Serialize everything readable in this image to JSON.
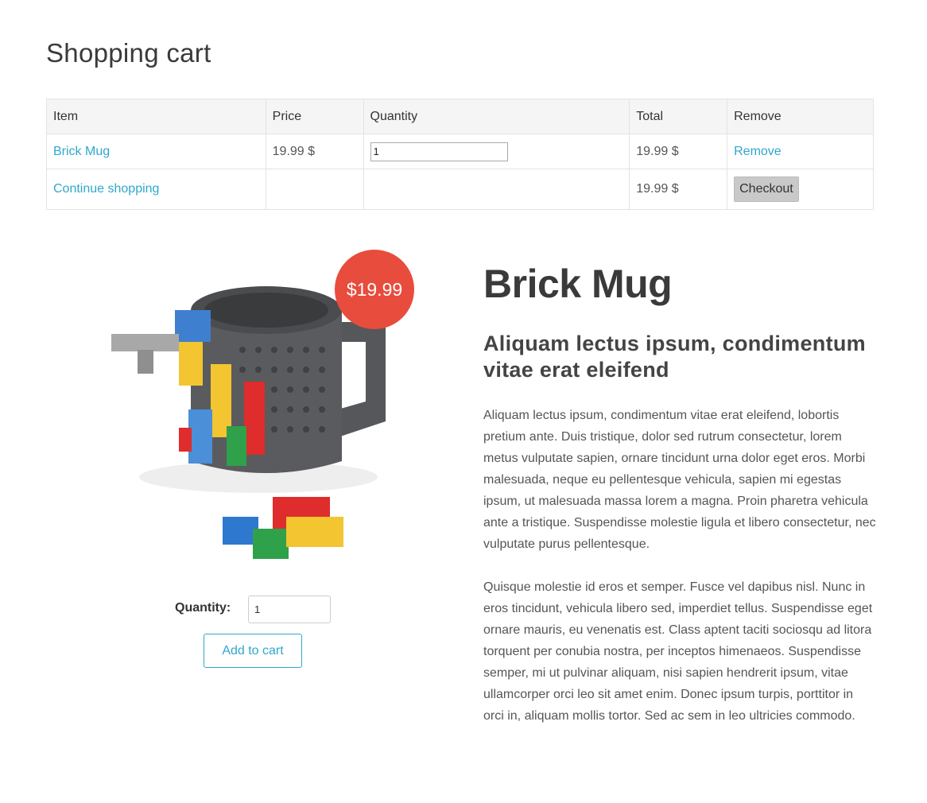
{
  "page": {
    "title": "Shopping cart"
  },
  "cart": {
    "headers": {
      "item": "Item",
      "price": "Price",
      "quantity": "Quantity",
      "total": "Total",
      "remove": "Remove"
    },
    "items": [
      {
        "name": "Brick Mug",
        "price": "19.99 $",
        "quantity": "1",
        "total": "19.99 $",
        "remove_label": "Remove"
      }
    ],
    "footer": {
      "continue_label": "Continue shopping",
      "grand_total": "19.99 $",
      "checkout_label": "Checkout"
    }
  },
  "product": {
    "price_badge": "$19.99",
    "title": "Brick Mug",
    "subtitle": "Aliquam lectus ipsum, condimentum vitae erat eleifend",
    "quantity_label": "Quantity:",
    "quantity_value": "1",
    "add_to_cart_label": "Add to cart",
    "description": [
      "Aliquam lectus ipsum, condimentum vitae erat eleifend, lobortis pretium ante. Duis tristique, dolor sed rutrum consectetur, lorem metus vulputate sapien, ornare tincidunt urna dolor eget eros. Morbi malesuada, neque eu pellentesque vehicula, sapien mi egestas ipsum, ut malesuada massa lorem a magna. Proin pharetra vehicula ante a tristique. Suspendisse molestie ligula et libero consectetur, nec vulputate purus pellentesque.",
      "Quisque molestie id eros et semper. Fusce vel dapibus nisl. Nunc in eros tincidunt, vehicula libero sed, imperdiet tellus. Suspendisse eget ornare mauris, eu venenatis est. Class aptent taciti sociosqu ad litora torquent per conubia nostra, per inceptos himenaeos. Suspendisse semper, mi ut pulvinar aliquam, nisi sapien hendrerit ipsum, vitae ullamcorper orci leo sit amet enim. Donec ipsum turpis, porttitor in orci in, aliquam mollis tortor. Sed ac sem in leo ultricies commodo."
    ]
  },
  "colors": {
    "link": "#2fa8cc",
    "badge": "#e84c3d",
    "mug": "#5a5b5e"
  }
}
